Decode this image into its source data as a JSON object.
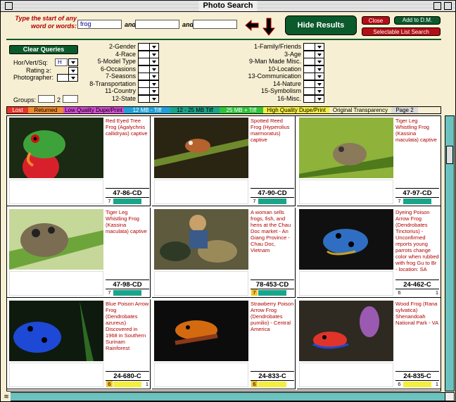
{
  "window": {
    "title": "Photo Search"
  },
  "search": {
    "prompt": "Type the start of any word or words:",
    "field1": "frog",
    "field2": "",
    "field3": "",
    "and_label": "and"
  },
  "buttons": {
    "hide_results": "Hide Results",
    "close": "Close",
    "add_to_dm": "Add to D.M.",
    "selectable_list": "Selectable List Search",
    "clear_queries": "Clear Queries"
  },
  "filters": {
    "hor_vert_sq_label": "Hor/Vert/Sq:",
    "hor_vert_sq_value": "H",
    "rating_label": "Rating ≥:",
    "photographer_label": "Photographer:",
    "groups_label": "Groups:",
    "groups_1": "1",
    "groups_2": "2"
  },
  "categories_left": [
    "2-Gender",
    "4-Race",
    "5-Model Type",
    "6-Occasions",
    "7-Seasons",
    "8-Transportation",
    "11-Country",
    "12-State"
  ],
  "categories_right": [
    "1-Family/Friends",
    "3-Age",
    "9-Man Made Misc.",
    "10-Location",
    "13-Communication",
    "14-Nature",
    "15-Symbolism",
    "16-Misc."
  ],
  "legend": [
    {
      "label": "Lost",
      "color": "#e8332a",
      "text": "#ffffff"
    },
    {
      "label": "Returned",
      "color": "#f08a2c",
      "text": "#000000"
    },
    {
      "label": "Low Quality Dupe/Print",
      "color": "#d64bd6",
      "text": "#000000"
    },
    {
      "label": "12 MB - Tiff",
      "color": "#1fa0d8",
      "text": "#ffffff"
    },
    {
      "label": "12 - 25 MB Tiff",
      "color": "#1aa58a",
      "text": "#000000"
    },
    {
      "label": "25 MB + Tiff",
      "color": "#2fc43a",
      "text": "#ffffff"
    },
    {
      "label": "High Quality Dupe/Print",
      "color": "#f4ef3c",
      "text": "#000000"
    },
    {
      "label": "Original Transparency",
      "color": "#f3efc0",
      "text": "#000000"
    },
    {
      "label": "Page 2",
      "color": "#d9d9d9",
      "text": "#000000"
    }
  ],
  "results": [
    {
      "desc": "Red Eyed Tree Frog (Agalychnis callidryas) captive",
      "code": "47-86-CD",
      "num": "7",
      "bar_color": "#1aa58a",
      "num2": ""
    },
    {
      "desc": "Spotted Reed Frog (Hyperolius marmoratus) captive",
      "code": "47-90-CD",
      "num": "7",
      "bar_color": "#1aa58a",
      "num2": ""
    },
    {
      "desc": "Tiger Leg Whistling Frog (Kassina maculata) captive",
      "code": "47-97-CD",
      "num": "7",
      "bar_color": "#1aa58a",
      "num2": ""
    },
    {
      "desc": "Tiger Leg Whistling Frog (Kassina maculata) captive",
      "code": "47-98-CD",
      "num": "7",
      "bar_color": "#1aa58a",
      "num2": ""
    },
    {
      "desc": "A woman sells frogs, fish, and hens at the Chau Doc market - An Giang Province - Chau Doc, Vietnam",
      "code": "78-453-CD",
      "num": "7",
      "bar_color": "#1aa58a",
      "num2": "",
      "num_bg": "#f4c430"
    },
    {
      "desc": "Dyeing Poison Arrow Frog (Dendrobates Tinctorius) - Unconfirmed reports young parrots change color when rubbed with frog Gu to Br - location: SA",
      "code": "24-462-C",
      "num": "6",
      "bar_color": "#ffffff",
      "num2": "1"
    },
    {
      "desc": "Blue Poison Arrow Frog (Dendrobates azureus) Discovered in 1968 in Southern Surinam Rainforest",
      "code": "24-680-C",
      "num": "6",
      "bar_color": "#f4ef3c",
      "num2": "1",
      "num_bg": "#f4c430"
    },
    {
      "desc": "Strawberry Poison Arrow Frog (Dendrobates pumilio) - Central America",
      "code": "24-833-C",
      "num": "6",
      "bar_color": "#f4ef3c",
      "num2": "",
      "num_bg": "#f4c430"
    },
    {
      "desc": "Wood Frog (Rana sylvatica) Shenandoah National Park - VA",
      "code": "24-835-C",
      "num": "6",
      "bar_color": "#f4ef3c",
      "num2": "1"
    }
  ]
}
